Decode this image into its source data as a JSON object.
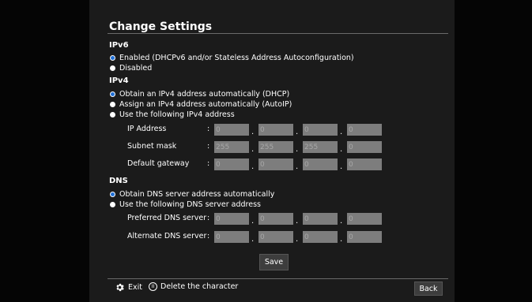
{
  "title": "Change Settings",
  "ipv6": {
    "heading": "IPv6",
    "options": [
      {
        "label": "Enabled (DHCPv6 and/or Stateless Address Autoconfiguration)",
        "selected": true
      },
      {
        "label": "Disabled",
        "selected": false
      }
    ]
  },
  "ipv4": {
    "heading": "IPv4",
    "options": [
      {
        "label": "Obtain an IPv4 address automatically (DHCP)",
        "selected": true
      },
      {
        "label": "Assign an IPv4 address automatically (AutoIP)",
        "selected": false
      },
      {
        "label": "Use the following IPv4 address",
        "selected": false
      }
    ],
    "fields": [
      {
        "label": "IP Address",
        "values": [
          "0",
          "0",
          "0",
          "0"
        ]
      },
      {
        "label": "Subnet mask",
        "values": [
          "255",
          "255",
          "255",
          "0"
        ]
      },
      {
        "label": "Default gateway",
        "values": [
          "0",
          "0",
          "0",
          "0"
        ]
      }
    ]
  },
  "dns": {
    "heading": "DNS",
    "options": [
      {
        "label": "Obtain DNS server address automatically",
        "selected": true
      },
      {
        "label": "Use the following DNS server address",
        "selected": false
      }
    ],
    "fields": [
      {
        "label": "Preferred DNS server",
        "values": [
          "0",
          "0",
          "0",
          "0"
        ]
      },
      {
        "label": "Alternate DNS server",
        "values": [
          "0",
          "0",
          "0",
          "0"
        ]
      }
    ]
  },
  "colon": ":",
  "separator": ".",
  "save_label": "Save",
  "footer": {
    "exit_label": "Exit",
    "exit_icon": "gear-icon",
    "delete_icon_glyph": "II",
    "delete_icon": "pause-circle-icon",
    "delete_label": "Delete the character",
    "back_label": "Back"
  },
  "colors": {
    "background": "#050505",
    "panel": "#1b1b1b",
    "radio_selected": "#1f6fd6",
    "input_bg": "#7d7d7d",
    "input_text": "#a8a8a8"
  }
}
